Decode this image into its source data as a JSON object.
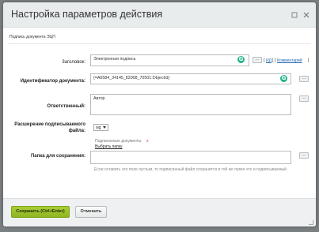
{
  "dialog": {
    "title": "Настройка параметров действия"
  },
  "section": {
    "title": "Подпись документа ЭЦП"
  },
  "fields": {
    "heading": {
      "label": "Заголовок:",
      "value": "Электронная подпись",
      "link_id": "ИД",
      "link_comment": "Комментарий"
    },
    "doc_id": {
      "label": "Идентификатор документа:",
      "value": "{=A6584_34145_82008_70501:ObjectId}"
    },
    "responsible": {
      "label": "Ответственный:",
      "value": "Автор"
    },
    "extension": {
      "label_line1": "Расширение подписываемого",
      "label_line2": "файла:",
      "value": "sig"
    },
    "save_folder": {
      "label": "Папка для сохранения:",
      "documents_label": "Подписанные документы",
      "required_mark": "x",
      "choose_folder": "Выбрать папку",
      "hint": "Если оставить это поле пустым, то подписанный файл сохранится в той же папке что и подписываемый."
    }
  },
  "buttons": {
    "dots": "...",
    "save": "Сохранить (Ctrl+Enter)",
    "cancel": "Отменить"
  },
  "icons": {
    "grammarly": "G"
  },
  "colors": {
    "accent_green": "#8fb520",
    "link_blue": "#2067b0",
    "grammarly_green": "#21b48a"
  }
}
